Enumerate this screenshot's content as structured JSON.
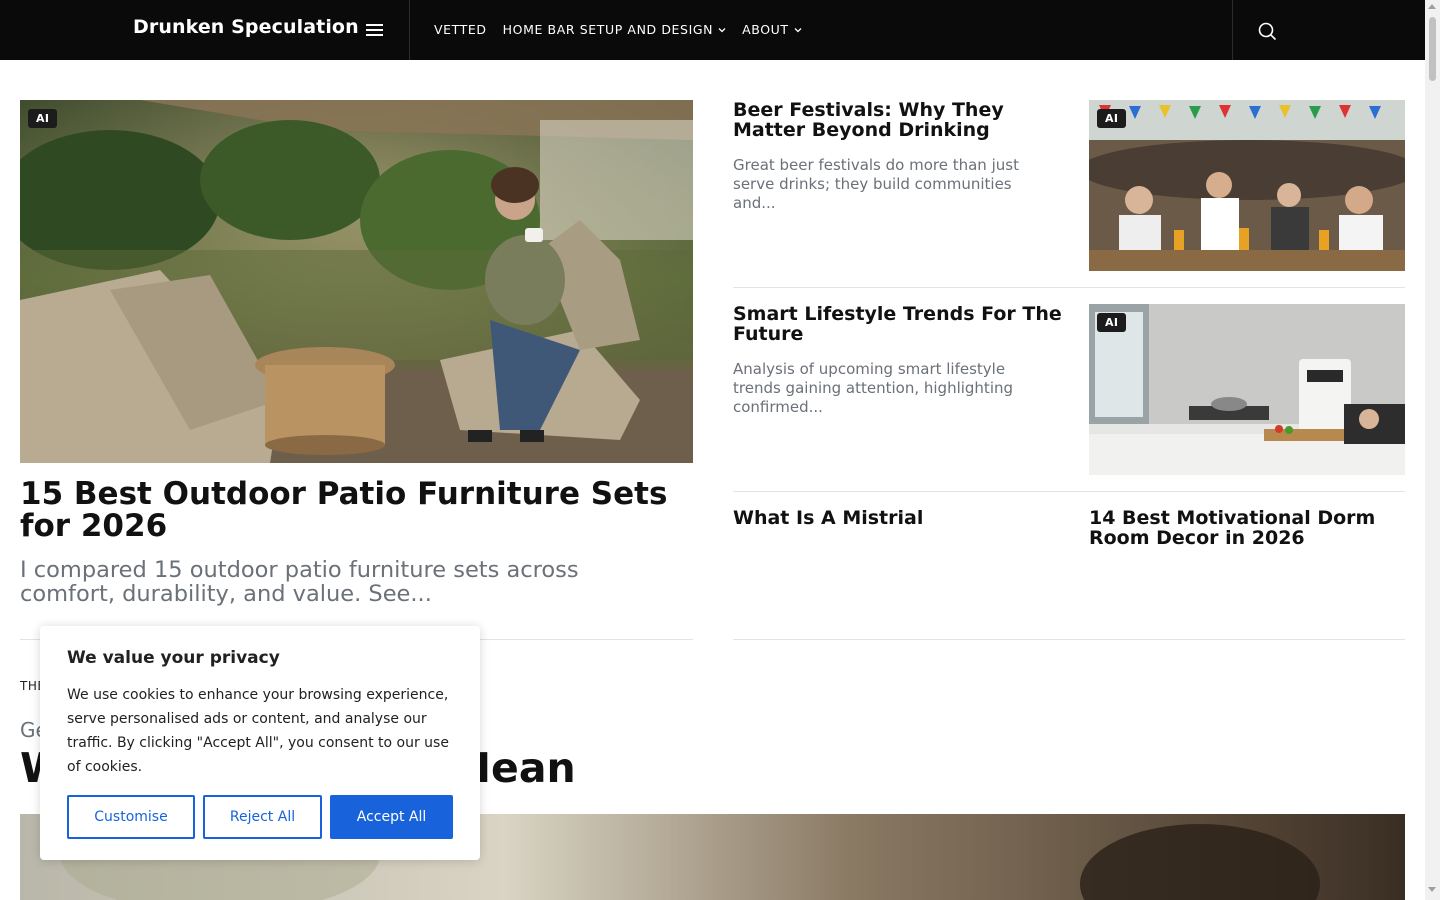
{
  "header": {
    "brand": "Drunken Speculation",
    "nav": [
      {
        "label": "VETTED",
        "has_dropdown": false
      },
      {
        "label": "HOME BAR SETUP AND DESIGN",
        "has_dropdown": true
      },
      {
        "label": "ABOUT",
        "has_dropdown": true
      }
    ],
    "icons": {
      "menu": "hamburger-icon",
      "search": "search-icon",
      "dropdown": "chevron-down-icon"
    }
  },
  "hero": {
    "badge": "AI",
    "title": "15 Best Outdoor Patio Furniture Sets for 2026",
    "excerpt": "I compared 15 outdoor patio furniture sets across comfort, durability, and value. See..."
  },
  "side_posts": [
    {
      "title": "Beer Festivals: Why They Matter Beyond Drinking",
      "excerpt": "Great beer festivals do more than just serve drinks; they build communities and...",
      "badge": "AI"
    },
    {
      "title": "Smart Lifestyle Trends For The Future",
      "excerpt": "Analysis of upcoming smart lifestyle trends gaining attention, highlighting confirmed...",
      "badge": "AI"
    },
    {
      "title": "What Is A Mistrial"
    },
    {
      "title": "14 Best Motivational Dorm Room Decor in 2026"
    }
  ],
  "section": {
    "label": "THE",
    "subtitle": "Ge",
    "title_start": "W",
    "title_end": "Mean"
  },
  "cookie": {
    "title": "We value your privacy",
    "text": "We use cookies to enhance your browsing experience, serve personalised ads or content, and analyse our traffic. By clicking \"Accept All\", you consent to our use of cookies.",
    "buttons": {
      "customise": "Customise",
      "reject": "Reject All",
      "accept": "Accept All"
    }
  },
  "colors": {
    "header_bg": "#0a0a0a",
    "accent_blue": "#1863dc",
    "muted_text": "#6b7178",
    "badge_bg": "#1c1c1c"
  }
}
